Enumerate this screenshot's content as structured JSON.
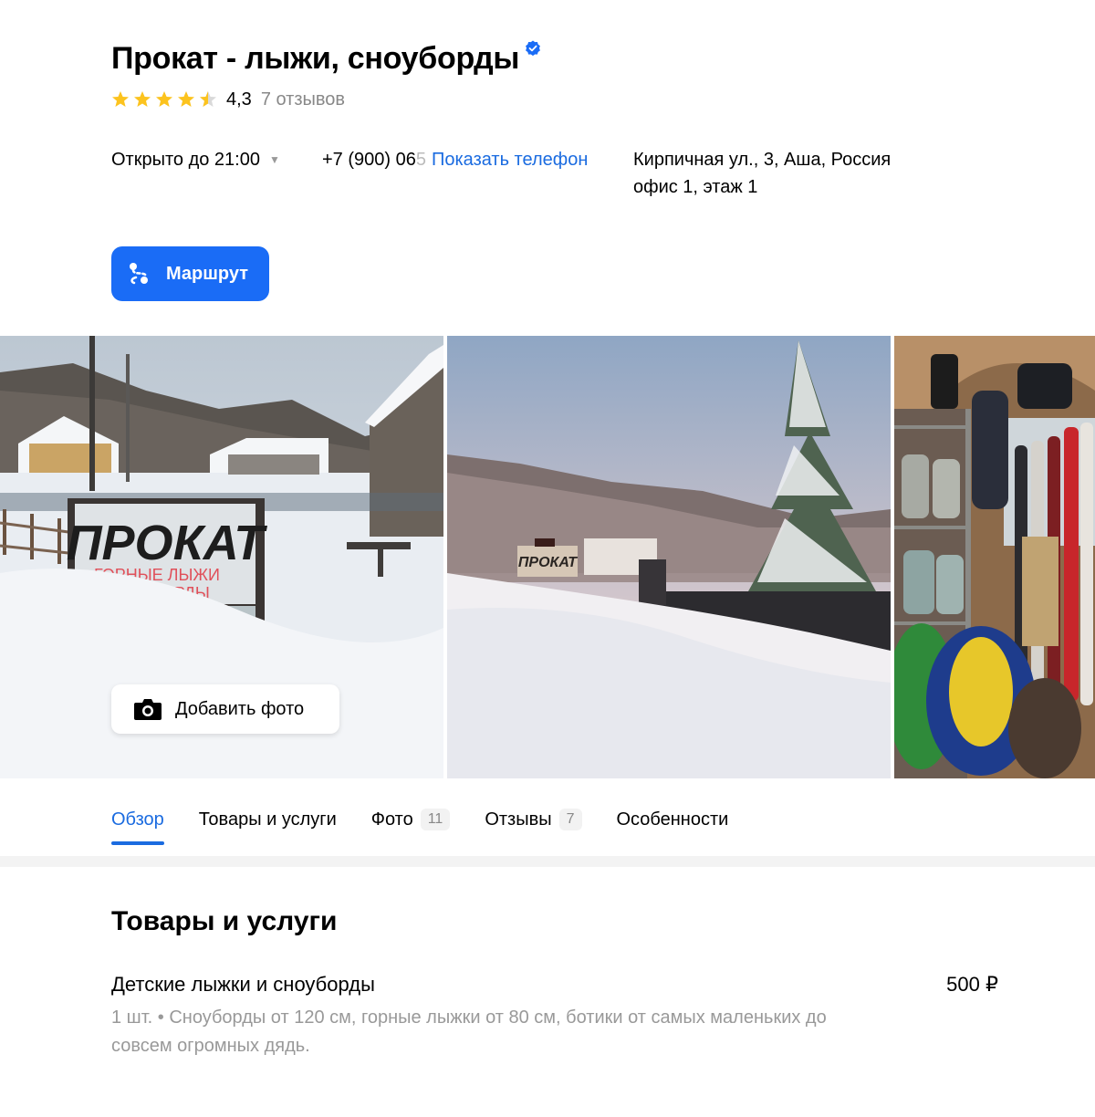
{
  "header": {
    "title": "Прокат - лыжи, сноуборды",
    "rating_value": "4,3",
    "reviews_label": "7 отзывов",
    "stars": 4.5
  },
  "info": {
    "hours": "Открыто до 21:00",
    "phone_visible": "+7 (900) 06",
    "phone_faded": "5",
    "phone_show_label": "Показать телефон",
    "address_line1": "Кирпичная ул., 3, Аша, Россия",
    "address_line2": "офис 1, этаж 1"
  },
  "actions": {
    "route_label": "Маршрут",
    "add_photo_label": "Добавить фото"
  },
  "photos": {
    "sign_big": "ПРОКАТ",
    "sign_line1": "ГОРНЫЕ ЛЫЖИ",
    "sign_line2": "СНОУБОРДЫ",
    "sign_small": "ПРОКАТ"
  },
  "tabs": [
    {
      "label": "Обзор",
      "count": ""
    },
    {
      "label": "Товары и услуги",
      "count": ""
    },
    {
      "label": "Фото",
      "count": "11"
    },
    {
      "label": "Отзывы",
      "count": "7"
    },
    {
      "label": "Особенности",
      "count": ""
    }
  ],
  "goods": {
    "section_title": "Товары и услуги",
    "items": [
      {
        "name": "Детские лыжки и сноуборды",
        "price": "500 ₽",
        "description": "1 шт. • Сноуборды от 120 см, горные лыжки от 80 см, ботики от самых маленьких до совсем огромных дядь."
      }
    ]
  },
  "colors": {
    "accent": "#1a6cf6",
    "link": "#1a6be0",
    "star": "#fcc31e",
    "verified": "#1a6cf6"
  }
}
